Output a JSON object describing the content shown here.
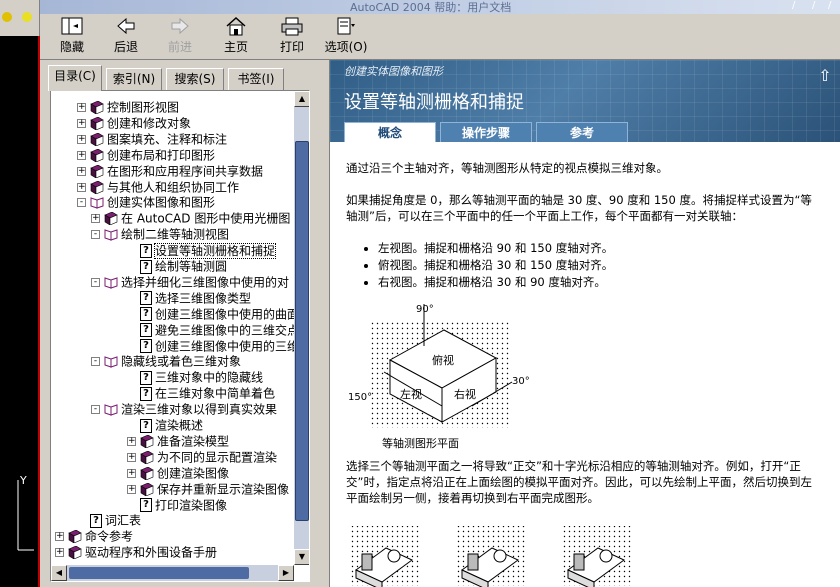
{
  "window": {
    "title": "AutoCAD 2004 帮助：用户文档"
  },
  "toolbar": {
    "hide": "隐藏",
    "back": "后退",
    "forward": "前进",
    "home": "主页",
    "print": "打印",
    "options": "选项(O)"
  },
  "nav_tabs": [
    "目录(C)",
    "索引(N)",
    "搜索(S)",
    "书签(I)"
  ],
  "tree": [
    {
      "text": "控制图形视图",
      "type": "book",
      "level": 1,
      "expander": "+"
    },
    {
      "text": "创建和修改对象",
      "type": "book",
      "level": 1,
      "expander": "+"
    },
    {
      "text": "图案填充、注释和标注",
      "type": "book",
      "level": 1,
      "expander": "+"
    },
    {
      "text": "创建布局和打印图形",
      "type": "book",
      "level": 1,
      "expander": "+"
    },
    {
      "text": "在图形和应用程序间共享数据",
      "type": "book",
      "level": 1,
      "expander": "+"
    },
    {
      "text": "与其他人和组织协同工作",
      "type": "book",
      "level": 1,
      "expander": "+"
    },
    {
      "text": "创建实体图像和图形",
      "type": "open-book",
      "level": 1,
      "expander": "-"
    },
    {
      "text": "在 AutoCAD 图形中使用光栅图",
      "type": "book",
      "level": 2,
      "expander": "+"
    },
    {
      "text": "绘制二维等轴测视图",
      "type": "open-book",
      "level": 2,
      "expander": "-"
    },
    {
      "text": "设置等轴测栅格和捕捉",
      "type": "page",
      "level": 3,
      "expander": "",
      "selected": true
    },
    {
      "text": "绘制等轴测圆",
      "type": "page",
      "level": 3,
      "expander": ""
    },
    {
      "text": "选择并细化三维图像中使用的对",
      "type": "open-book",
      "level": 2,
      "expander": "-"
    },
    {
      "text": "选择三维图像类型",
      "type": "page",
      "level": 3,
      "expander": ""
    },
    {
      "text": "创建三维图像中使用的曲面",
      "type": "page",
      "level": 3,
      "expander": ""
    },
    {
      "text": "避免三维图像中的三维交点",
      "type": "page",
      "level": 3,
      "expander": ""
    },
    {
      "text": "创建三维图像中使用的三维",
      "type": "page",
      "level": 3,
      "expander": ""
    },
    {
      "text": "隐藏线或着色三维对象",
      "type": "open-book",
      "level": 2,
      "expander": "-"
    },
    {
      "text": "三维对象中的隐藏线",
      "type": "page",
      "level": 3,
      "expander": ""
    },
    {
      "text": "在三维对象中简单着色",
      "type": "page",
      "level": 3,
      "expander": ""
    },
    {
      "text": "渲染三维对象以得到真实效果",
      "type": "open-book",
      "level": 2,
      "expander": "-"
    },
    {
      "text": "渲染概述",
      "type": "page",
      "level": 3,
      "expander": ""
    },
    {
      "text": "准备渲染模型",
      "type": "book",
      "level": 3,
      "expander": "+"
    },
    {
      "text": "为不同的显示配置渲染",
      "type": "book",
      "level": 3,
      "expander": "+"
    },
    {
      "text": "创建渲染图像",
      "type": "book",
      "level": 3,
      "expander": "+"
    },
    {
      "text": "保存并重新显示渲染图像",
      "type": "book",
      "level": 3,
      "expander": "+"
    },
    {
      "text": "打印渲染图像",
      "type": "page",
      "level": 3,
      "expander": ""
    },
    {
      "text": "词汇表",
      "type": "page",
      "level": 1,
      "expander": ""
    },
    {
      "text": "命令参考",
      "type": "book",
      "level": 0,
      "expander": "+"
    },
    {
      "text": "驱动程序和外围设备手册",
      "type": "book",
      "level": 0,
      "expander": "+"
    }
  ],
  "content": {
    "breadcrumb": "创建实体图像和图形",
    "heading": "设置等轴测栅格和捕捉",
    "tabs": [
      "概念",
      "操作步骤",
      "参考"
    ],
    "para1": "通过沿三个主轴对齐，等轴测图形从特定的视点模拟三维对象。",
    "para2": "如果捕捉角度是 0，那么等轴测平面的轴是 30 度、90 度和 150 度。将捕捉样式设置为“等轴测”后，可以在三个平面中的任一个平面上工作，每个平面都有一对关联轴：",
    "bullets": [
      "左视图。捕捉和栅格沿 90 和 150 度轴对齐。",
      "俯视图。捕捉和栅格沿 30 和 150 度轴对齐。",
      "右视图。捕捉和栅格沿 30 和 90 度轴对齐。"
    ],
    "figure": {
      "angle_top": "90°",
      "angle_left": "150°",
      "angle_right": "30°",
      "label_top": "俯视",
      "label_left": "左视",
      "label_right": "右视",
      "caption": "等轴测图形平面"
    },
    "para3": "选择三个等轴测平面之一将导致“正交”和十字光标沿相应的等轴测轴对齐。例如，打开“正交”时，指定点将沿正在上面绘图的模拟平面对齐。因此，可以先绘制上平面，然后切换到左平面绘制另一侧，接着再切换到右平面完成图形。"
  },
  "colors": {
    "banner": "#3a6b96",
    "tab": "#4f81b0",
    "book": "#7a1f6f",
    "scroll_thumb": "#4f6ba3"
  }
}
